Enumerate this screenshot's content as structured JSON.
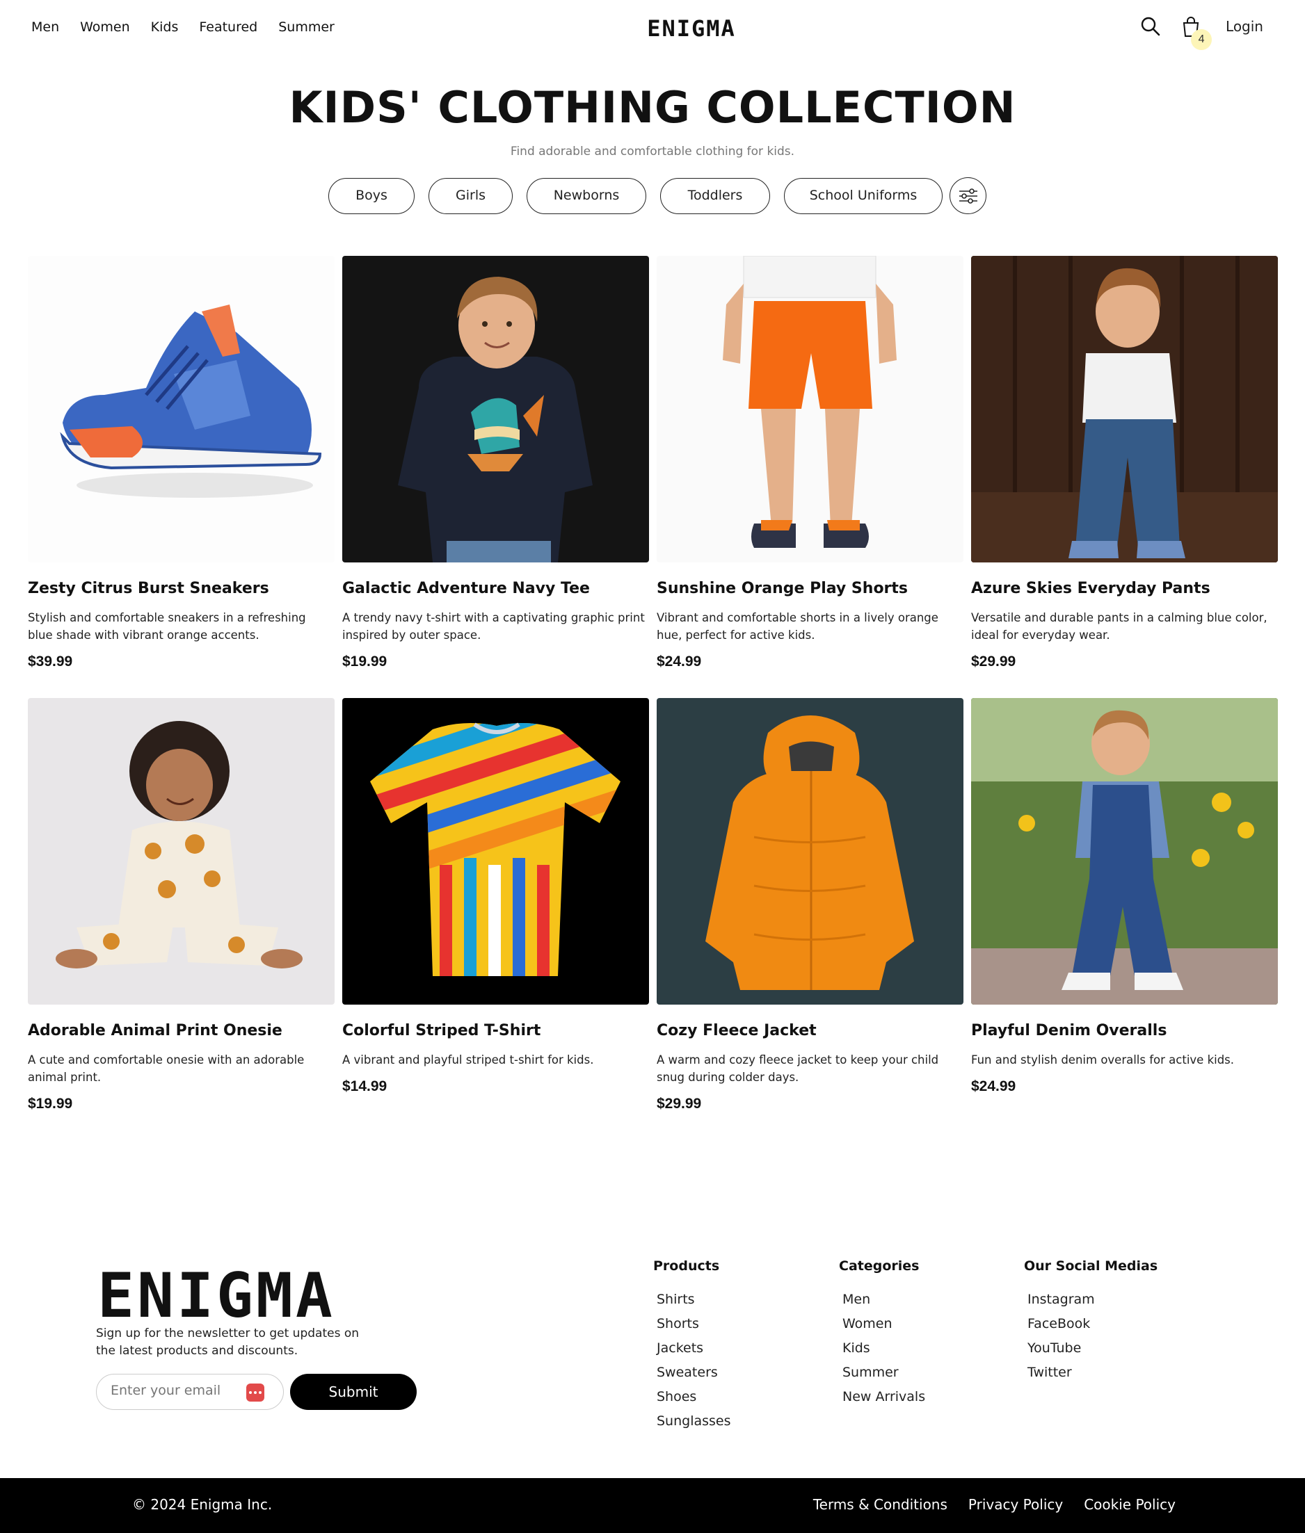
{
  "header": {
    "nav": [
      "Men",
      "Women",
      "Kids",
      "Featured",
      "Summer"
    ],
    "brand": "ENIGMA",
    "cart_count": "4",
    "login_label": "Login",
    "icons": [
      "search-icon",
      "shopping-bag-icon"
    ]
  },
  "hero": {
    "title": "KIDS' CLOTHING COLLECTION",
    "subtitle": "Find adorable and comfortable clothing for kids."
  },
  "filters": {
    "pills": [
      "Boys",
      "Girls",
      "Newborns",
      "Toddlers",
      "School Uniforms"
    ],
    "icon": "sliders-icon"
  },
  "products": [
    {
      "name": "Zesty Citrus Burst Sneakers",
      "description": "Stylish and comfortable sneakers in a refreshing blue shade with vibrant orange accents.",
      "price": "$39.99"
    },
    {
      "name": "Galactic Adventure Navy Tee",
      "description": "A trendy navy t-shirt with a captivating graphic print inspired by outer space.",
      "price": "$19.99"
    },
    {
      "name": "Sunshine Orange Play Shorts",
      "description": "Vibrant and comfortable shorts in a lively orange hue, perfect for active kids.",
      "price": "$24.99"
    },
    {
      "name": "Azure Skies Everyday Pants",
      "description": "Versatile and durable pants in a calming blue color, ideal for everyday wear.",
      "price": "$29.99"
    },
    {
      "name": "Adorable Animal Print Onesie",
      "description": "A cute and comfortable onesie with an adorable animal print.",
      "price": "$19.99"
    },
    {
      "name": "Colorful Striped T-Shirt",
      "description": "A vibrant and playful striped t-shirt for kids.",
      "price": "$14.99"
    },
    {
      "name": "Cozy Fleece Jacket",
      "description": "A warm and cozy fleece jacket to keep your child snug during colder days.",
      "price": "$29.99"
    },
    {
      "name": "Playful Denim Overalls",
      "description": "Fun and stylish denim overalls for active kids.",
      "price": "$24.99"
    }
  ],
  "footer": {
    "brand": "ENIGMA",
    "newsletter_text": "Sign up for the newsletter to get updates on the latest products and discounts.",
    "email_placeholder": "Enter your email",
    "submit_label": "Submit",
    "columns": [
      {
        "title": "Products",
        "links": [
          "Shirts",
          "Shorts",
          "Jackets",
          "Sweaters",
          "Shoes",
          "Sunglasses"
        ]
      },
      {
        "title": "Categories",
        "links": [
          "Men",
          "Women",
          "Kids",
          "Summer",
          "New Arrivals"
        ]
      },
      {
        "title": "Our Social Medias",
        "links": [
          "Instagram",
          "FaceBook",
          "YouTube",
          "Twitter"
        ]
      }
    ],
    "copyright": "© 2024 Enigma Inc.",
    "legal": [
      "Terms & Conditions",
      "Privacy Policy",
      "Cookie Policy"
    ]
  },
  "colors": {
    "badge": "#fdf5b8",
    "email_icon": "#e24a4a",
    "bottom_bar": "#000000"
  }
}
